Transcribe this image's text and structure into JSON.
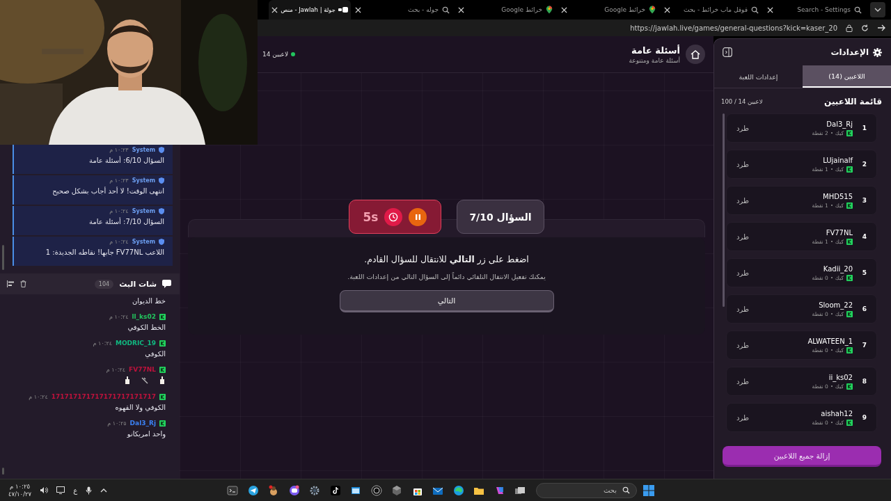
{
  "browser": {
    "tabs": [
      {
        "label": "Search - Settings",
        "kind": "search",
        "selected": false
      },
      {
        "label": "قوقل ماب خرائط - بحث",
        "kind": "search",
        "selected": false
      },
      {
        "label": "خرائط Google",
        "kind": "pin",
        "selected": false
      },
      {
        "label": "خرائط Google",
        "kind": "pin",
        "selected": false
      },
      {
        "label": "جوله - بحث",
        "kind": "search",
        "selected": false
      },
      {
        "label": "جولة | Jawlah - منص",
        "kind": "logo",
        "selected": true
      }
    ],
    "address": "https://jawlah.live/games/general-questions?kick=kaser_20"
  },
  "chat": {
    "system_messages": [
      {
        "sender": "System",
        "time": "١٠:٢٣ م",
        "text": "السؤال 6/10: أسئلة عامة"
      },
      {
        "sender": "System",
        "time": "١٠:٢٣ م",
        "text": "انتهى الوقت! لا أحد أجاب بشكل صحيح"
      },
      {
        "sender": "System",
        "time": "١٠:٢٤ م",
        "text": "السؤال 7/10: أسئلة عامة"
      },
      {
        "sender": "System",
        "time": "١٠:٢٤ م",
        "text": "اللاعب FV77NL جابها! نقاطه الجديدة: 1"
      }
    ],
    "title": "شات البث",
    "count": "104",
    "messages": [
      {
        "kind": "text",
        "text": "خط الديوان"
      },
      {
        "kind": "text",
        "user": "ll_ks02",
        "color": "#22c55e",
        "time": "١٠:٢٤ م",
        "text": "الخط الكوفي"
      },
      {
        "kind": "text",
        "user": "MODRIC_19",
        "color": "#10b981",
        "time": "١٠:٢٤ م",
        "text": "الكوفي"
      },
      {
        "kind": "icons",
        "user": "FV77NL",
        "color": "#be123c",
        "time": "١٠:٢٤ م"
      },
      {
        "kind": "text",
        "user": "171717171717171717171717",
        "color": "#be123c",
        "time": "١٠:٢٤ م",
        "text": "الكوفي ولا القهوه"
      },
      {
        "kind": "text",
        "user": "Dal3_Rj",
        "color": "#3b82f6",
        "time": "١٠:٢٥ م",
        "text": "واحد امريكانو"
      }
    ]
  },
  "game": {
    "title": "أسئلة عامة",
    "subtitle": "أسئلة عامة ومتنوعة",
    "players": "14 لاعبين",
    "question": "السؤال 7/10",
    "timer": "5s",
    "prompt": "اضغط على زر **التالي** للانتقال للسؤال القادم.",
    "hint": "يمكنك تفعيل الانتقال التلقائي دائماً إلى السؤال التالي من إعدادات اللعبة.",
    "next_button": "التالي"
  },
  "settings": {
    "title": "الإعدادات",
    "tabs": [
      {
        "label": "اللاعبين (14)",
        "selected": true
      },
      {
        "label": "إعدادات اللعبة",
        "selected": false
      }
    ],
    "list_title": "قائمة اللاعبين",
    "capacity": "100 / 14 لاعبين",
    "players": [
      {
        "rank": "1",
        "name": "Dal3_Rj",
        "platform": "كيك",
        "points": "2 نقطة",
        "action": "طرد"
      },
      {
        "rank": "2",
        "name": "LUjainalf",
        "platform": "كيك",
        "points": "1 نقطة",
        "action": "طرد"
      },
      {
        "rank": "3",
        "name": "MHD515",
        "platform": "كيك",
        "points": "1 نقطة",
        "action": "طرد"
      },
      {
        "rank": "4",
        "name": "FV77NL",
        "platform": "كيك",
        "points": "1 نقطة",
        "action": "طرد"
      },
      {
        "rank": "5",
        "name": "Kadii_20",
        "platform": "كيك",
        "points": "0 نقطة",
        "action": "طرد"
      },
      {
        "rank": "6",
        "name": "Sloom_22",
        "platform": "كيك",
        "points": "0 نقطة",
        "action": "طرد"
      },
      {
        "rank": "7",
        "name": "ALWATEEN_1",
        "platform": "كيك",
        "points": "0 نقطة",
        "action": "طرد"
      },
      {
        "rank": "8",
        "name": "ii_ks02",
        "platform": "كيك",
        "points": "0 نقطة",
        "action": "طرد"
      },
      {
        "rank": "9",
        "name": "aishah12",
        "platform": "كيك",
        "points": "0 نقطة",
        "action": "طرد"
      }
    ],
    "remove_all": "إزالة جميع اللاعبين"
  },
  "taskbar": {
    "search_placeholder": "بحث",
    "language": "ع",
    "time": "١٠:٢٥ م",
    "date": "٤٧/١٠/٢٧"
  }
}
